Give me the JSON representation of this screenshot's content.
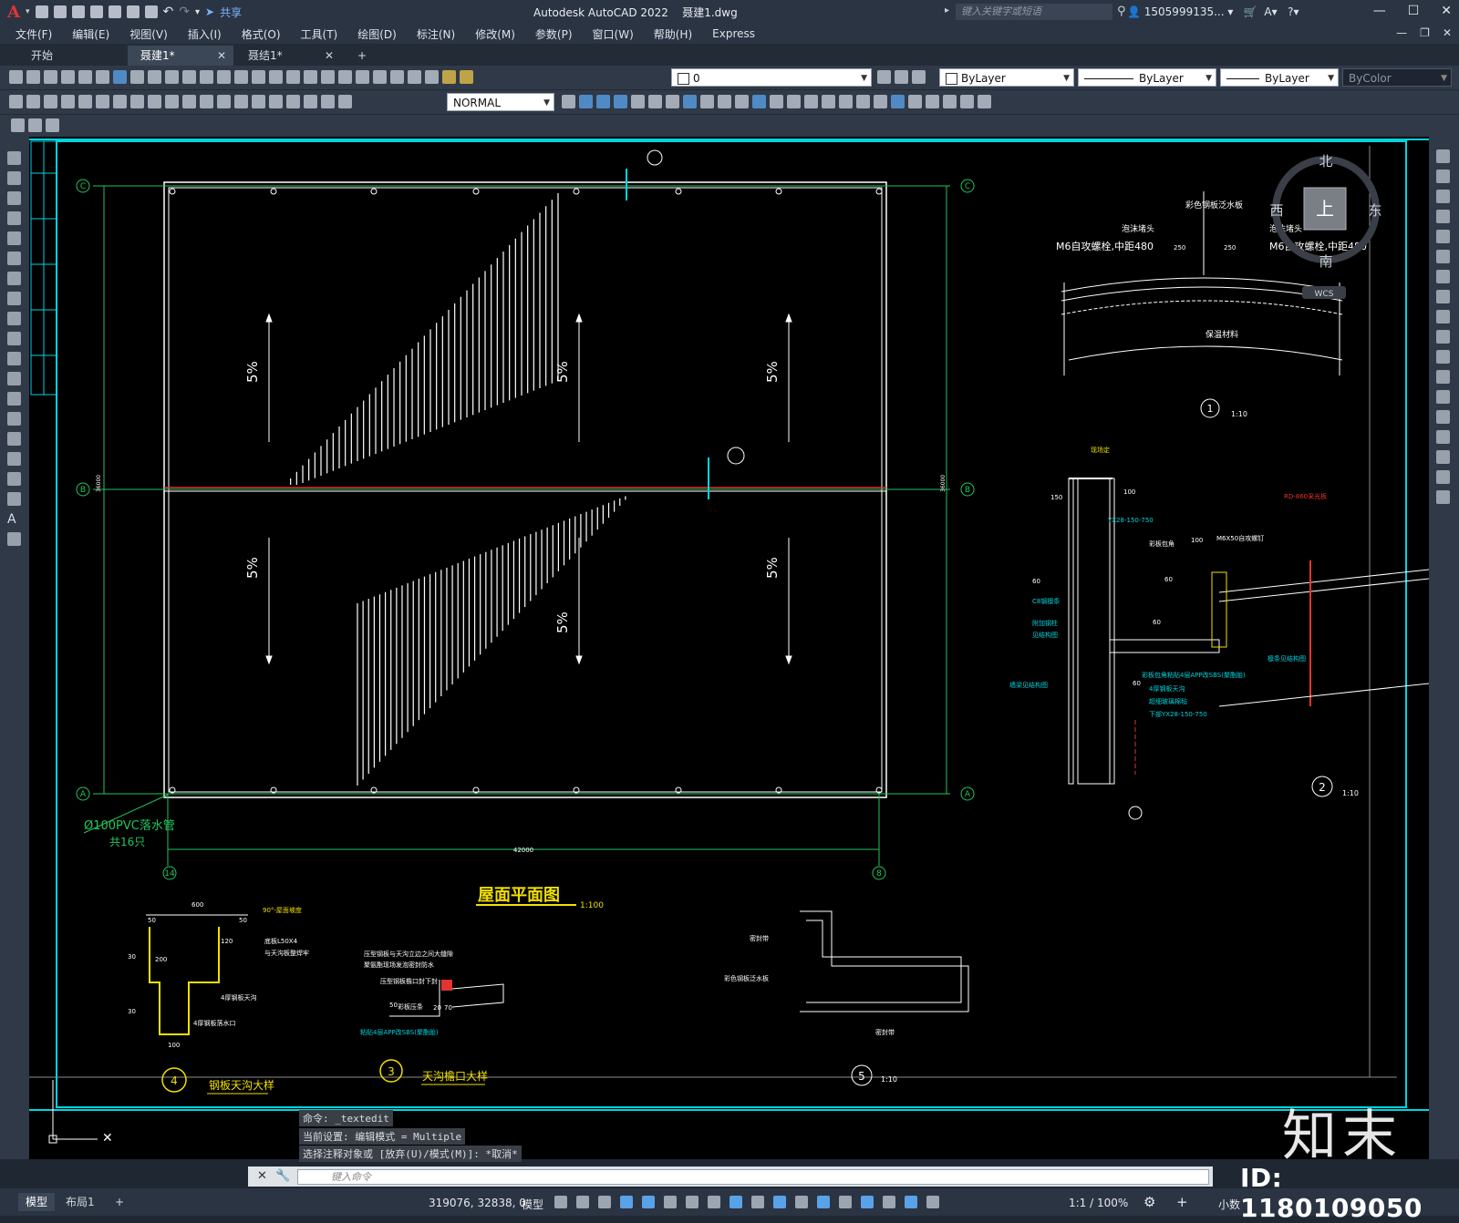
{
  "app": {
    "logo": "A",
    "title": "Autodesk AutoCAD 2022",
    "filename": "聂建1.dwg",
    "share_label": "共享",
    "search_placeholder": "键入关键字或短语",
    "user": "1505999135...",
    "window_controls": [
      "—",
      "☐",
      "✕"
    ]
  },
  "menu": [
    "文件(F)",
    "编辑(E)",
    "视图(V)",
    "插入(I)",
    "格式(O)",
    "工具(T)",
    "绘图(D)",
    "标注(N)",
    "修改(M)",
    "参数(P)",
    "窗口(W)",
    "帮助(H)",
    "Express"
  ],
  "tabs": [
    {
      "label": "开始",
      "active": false
    },
    {
      "label": "聂建1*",
      "active": true
    },
    {
      "label": "聂结1*",
      "active": false
    }
  ],
  "tab_add": "+",
  "layer_toolbar": {
    "layer": "0",
    "color": "ByLayer",
    "linetype": "ByLayer",
    "lineweight": "ByLayer",
    "plotstyle": "ByColor"
  },
  "dimstyle": "NORMAL",
  "viewcube": {
    "north": "北",
    "south": "南",
    "east": "东",
    "west": "西",
    "face": "上",
    "wcs": "WCS"
  },
  "drawing": {
    "plan_title": "屋面平面图",
    "plan_scale": "1:100",
    "slope": "5%",
    "grid_labels": {
      "c": "C",
      "b": "B",
      "a": "A",
      "col_left": "14",
      "col_right": "8"
    },
    "dim_width": "42000",
    "dim_h_top": "36000",
    "dim_h_bottom": "36000",
    "pipe_note_1": "Ø100PVC落水管",
    "pipe_note_2": "共16只",
    "detail1": {
      "num": "1",
      "scale": "1:10",
      "top_label": "彩色钢板泛水板",
      "left_label_1": "泡沫堵头",
      "left_label_2": "M6自攻螺栓,中距480",
      "right_label_1": "泡沫堵头",
      "right_label_2": "M6自攻螺栓,中距480",
      "dim_a": "250",
      "dim_b": "250",
      "bottom_label": "保温材料"
    },
    "detail2": {
      "num": "2",
      "scale": "1:10",
      "labels": [
        "现场定",
        "YX28-150-750",
        "彩板包角",
        "M6X50自攻螺钉",
        "RD-860采光板",
        "C8钢檩条",
        "附加钢柱",
        "见结构图",
        "檩条见结构图",
        "墙梁见结构图",
        "彩板包角粘贴4层APP改SBS(聚酯胎)",
        "4厚钢板天沟",
        "超细玻璃棉毡",
        "下部YX28-150-750"
      ],
      "dims": [
        "150",
        "100",
        "60",
        "60",
        "60",
        "60",
        "100"
      ]
    },
    "detail3": {
      "num": "3",
      "title": "天沟檐口大样",
      "labels": [
        "压型钢板与天沟立边之间大缝隙",
        "聚氨酯现场发泡密封防水",
        "压型钢板檐口封下封",
        "彩板压条",
        "粘贴4层APP改SBS(聚酯胎)"
      ],
      "dims": [
        "50",
        "20",
        "70"
      ]
    },
    "detail4": {
      "num": "4",
      "title": "钢板天沟大样",
      "labels": [
        "90°-屋面坡度",
        "底板L50X4",
        "与天沟板整焊牢",
        "4厚钢板天沟",
        "4厚钢板落水口"
      ],
      "dims": [
        "600",
        "50",
        "50",
        "120",
        "30",
        "200",
        "30",
        "100"
      ]
    },
    "detail5": {
      "num": "5",
      "scale": "1:10",
      "labels": [
        "密封带",
        "彩色钢板泛水板",
        "密封带"
      ]
    }
  },
  "command_history": [
    "命令: _textedit",
    "当前设置: 编辑模式 = Multiple",
    "选择注释对象或 [放弃(U)/模式(M)]: *取消*"
  ],
  "command_placeholder": "键入命令",
  "status": {
    "tabs": [
      {
        "label": "模型",
        "active": true
      },
      {
        "label": "布局1",
        "active": false
      }
    ],
    "coords": "319076, 32838, 0",
    "space": "模型",
    "scale": "1:1 / 100%",
    "units": "小数"
  },
  "watermark": {
    "logo": "知末",
    "id": "ID: 1180109050"
  },
  "colors": {
    "cyan": "#00d5e0",
    "green": "#22c55e",
    "yellow": "#f0e000",
    "red": "#e3342f",
    "white": "#ffffff"
  }
}
